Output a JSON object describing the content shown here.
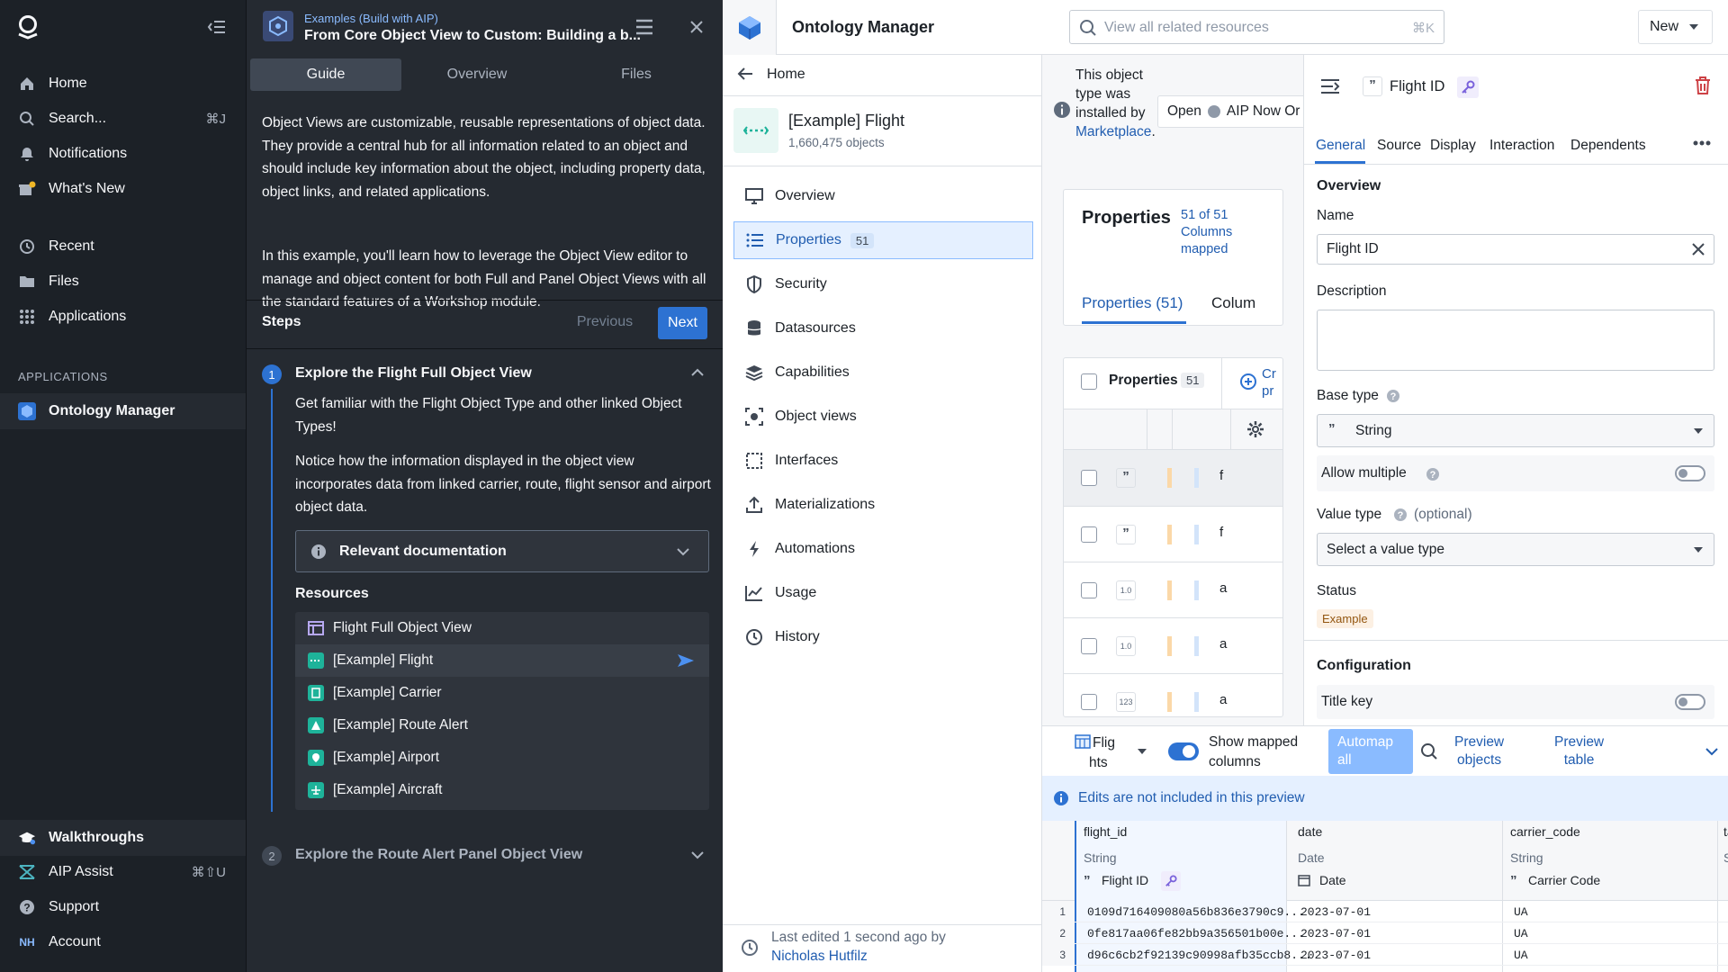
{
  "left_nav": {
    "items": [
      {
        "label": "Home"
      },
      {
        "label": "Search...",
        "shortcut": "⌘J"
      },
      {
        "label": "Notifications"
      },
      {
        "label": "What's New"
      },
      {
        "label": "Recent"
      },
      {
        "label": "Files"
      },
      {
        "label": "Applications"
      }
    ],
    "section_label": "APPLICATIONS",
    "app_item": "Ontology Manager",
    "bottom": [
      {
        "label": "Walkthroughs"
      },
      {
        "label": "AIP Assist",
        "shortcut": "⌘⇧U"
      },
      {
        "label": "Support"
      },
      {
        "label": "Account",
        "badge": "NH"
      }
    ]
  },
  "guide": {
    "breadcrumb": "Examples (Build with AIP)",
    "title": "From Core Object View to Custom: Building a b...",
    "tabs": [
      "Guide",
      "Overview",
      "Files"
    ],
    "para1": "Object Views are customizable, reusable representations of object data. They provide a central hub for all information related to an object and should include key information about the object, including property data, object links, and related applications.",
    "para2": "In this example, you'll learn how to leverage the Object View editor to manage and object content for both Full and Panel Object Views with all the standard features of a Workshop module.",
    "steps_label": "Steps",
    "previous": "Previous",
    "next": "Next",
    "step1": {
      "num": "1",
      "title": "Explore the Flight Full Object View",
      "text1": "Get familiar with the Flight Object Type and other linked Object Types!",
      "text2": "Notice how the information displayed in the object view incorporates data from linked carrier, route, flight sensor and airport object data.",
      "doc_label": "Relevant documentation",
      "resources_label": "Resources",
      "resources": [
        "Flight Full Object View",
        "[Example] Flight",
        "[Example] Carrier",
        "[Example] Route Alert",
        "[Example] Airport",
        "[Example] Aircraft"
      ]
    },
    "step2": {
      "num": "2",
      "title": "Explore the Route Alert Panel Object View"
    }
  },
  "ontology": {
    "app_title": "Ontology Manager",
    "search_placeholder": "View all related resources",
    "search_shortcut": "⌘K",
    "new_label": "New",
    "home_label": "Home",
    "object_name": "[Example] Flight",
    "object_count": "1,660,475 objects",
    "sidebar": [
      {
        "label": "Overview"
      },
      {
        "label": "Properties",
        "count": "51"
      },
      {
        "label": "Security"
      },
      {
        "label": "Datasources"
      },
      {
        "label": "Capabilities"
      },
      {
        "label": "Object views"
      },
      {
        "label": "Interfaces"
      },
      {
        "label": "Materializations"
      },
      {
        "label": "Automations"
      },
      {
        "label": "Usage"
      },
      {
        "label": "History"
      }
    ],
    "last_edited": "Last edited 1 second ago by",
    "last_edited_by": "Nicholas Hutfilz",
    "installed_notice": {
      "l1": "This object",
      "l2": "type was",
      "l3": "installed by",
      "link": "Marketplace",
      "open": "Open",
      "open_target": "AIP Now Or"
    },
    "properties_card": {
      "title": "Properties",
      "mapped_l1": "51 of 51",
      "mapped_l2": "Columns",
      "mapped_l3": "mapped",
      "tab_active": "Properties (51)",
      "tab2": "Colum"
    },
    "prop_list": {
      "header": "Properties",
      "count": "51",
      "create_l1": "Cr",
      "create_l2": "pr",
      "rows": [
        {
          "type": "”",
          "name": "f"
        },
        {
          "type": "”",
          "name": "f"
        },
        {
          "type": "1.0",
          "name": "a"
        },
        {
          "type": "1.0",
          "name": "a"
        },
        {
          "type": "123",
          "name": "a"
        }
      ]
    },
    "toolbar": {
      "dataset_l1": "Flig",
      "dataset_l2": "hts",
      "show_mapped_l1": "Show mapped",
      "show_mapped_l2": "columns",
      "automap_l1": "Automap",
      "automap_l2": "all",
      "preview_objects_l1": "Preview",
      "preview_objects_l2": "objects",
      "preview_table_l1": "Preview",
      "preview_table_l2": "table"
    },
    "edits_notice": "Edits are not included in this preview",
    "table": {
      "columns": [
        {
          "name": "flight_id",
          "type": "String",
          "prop": "Flight ID"
        },
        {
          "name": "date",
          "type": "Date",
          "prop": "Date"
        },
        {
          "name": "carrier_code",
          "type": "String",
          "prop": "Carrier Code"
        },
        {
          "name": "ta",
          "type": "S",
          "prop": ""
        }
      ],
      "rows": [
        {
          "n": "1",
          "flight_id": "0109d716409080a56b836e3790c9...",
          "date": "2023-07-01",
          "carrier": "UA"
        },
        {
          "n": "2",
          "flight_id": "0fe817aa06fe82bb9a356501b00e...",
          "date": "2023-07-01",
          "carrier": "UA"
        },
        {
          "n": "3",
          "flight_id": "d96c6cb2f92139c90998afb35ccb8...",
          "date": "2023-07-01",
          "carrier": "UA"
        }
      ]
    },
    "detail": {
      "title": "Flight ID",
      "tabs": [
        "General",
        "Source",
        "Display",
        "Interaction",
        "Dependents"
      ],
      "overview_label": "Overview",
      "name_label": "Name",
      "name_value": "Flight ID",
      "description_label": "Description",
      "base_type_label": "Base type",
      "base_type_value": "String",
      "allow_multiple_label": "Allow multiple",
      "value_type_label": "Value type",
      "value_type_optional": "(optional)",
      "value_type_placeholder": "Select a value type",
      "status_label": "Status",
      "status_value": "Example",
      "configuration_label": "Configuration",
      "title_key_label": "Title key"
    }
  }
}
